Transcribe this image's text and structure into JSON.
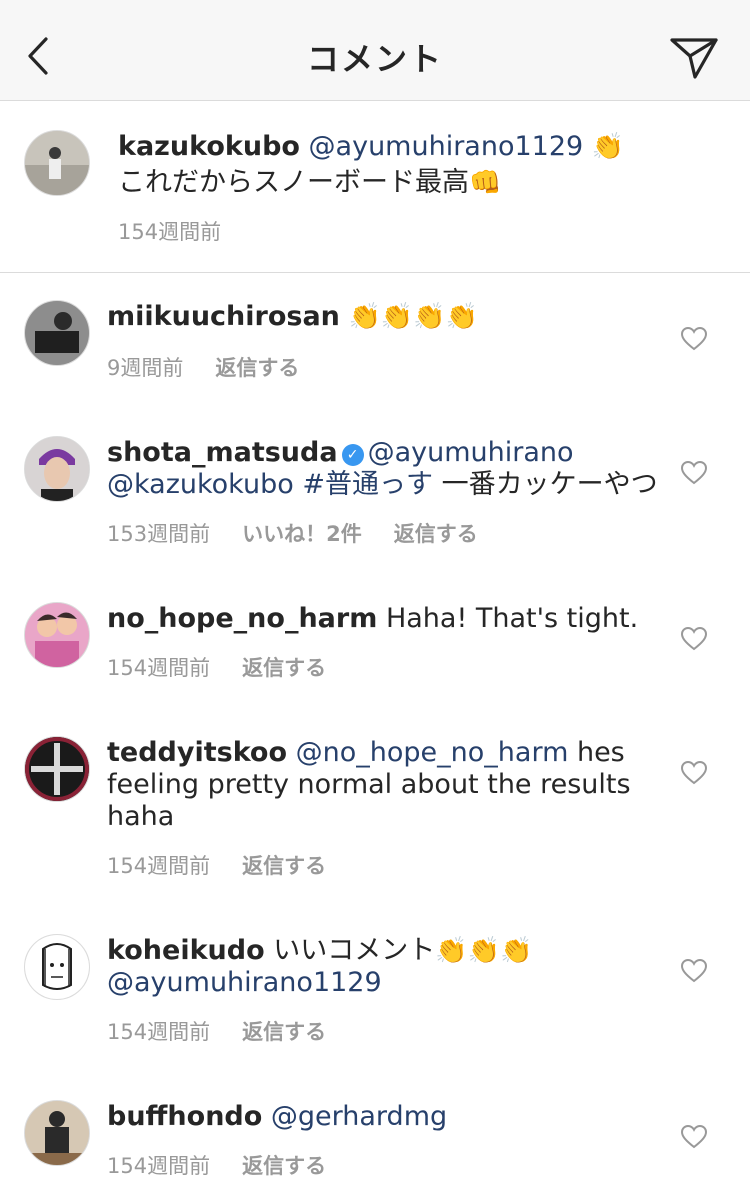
{
  "header": {
    "title": "コメント"
  },
  "caption": {
    "username": "kazukokubo",
    "mention": "@ayumuhirano1129",
    "emoji_after_mention": "👏",
    "line2": "これだからスノーボード最高",
    "emoji_line2": "👊",
    "time": "154週間前"
  },
  "comments": [
    {
      "username": "miikuuchirosan",
      "text": "👏👏👏👏",
      "time": "9週間前",
      "reply": "返信する"
    },
    {
      "username": "shota_matsuda",
      "verified": true,
      "mention1": "@ayumuhirano",
      "mention2": "@kazukokubo",
      "hashtag": "#普通っす",
      "text": " 一番カッケーやつ",
      "time": "153週間前",
      "likes": "いいね！2件",
      "reply": "返信する"
    },
    {
      "username": "no_hope_no_harm",
      "text": "Haha!  That's tight.",
      "time": "154週間前",
      "reply": "返信する"
    },
    {
      "username": "teddyitskoo",
      "mention": "@no_hope_no_harm",
      "text1": " hes",
      "text2": "feeling pretty normal about the results",
      "text3": "haha",
      "time": "154週間前",
      "reply": "返信する"
    },
    {
      "username": "koheikudo",
      "text": " いいコメント",
      "emoji": "👏👏👏",
      "mention": "@ayumuhirano1129",
      "time": "154週間前",
      "reply": "返信する"
    },
    {
      "username": "buffhondo",
      "mention": "@gerhardmg",
      "time": "154週間前",
      "reply": "返信する"
    }
  ]
}
